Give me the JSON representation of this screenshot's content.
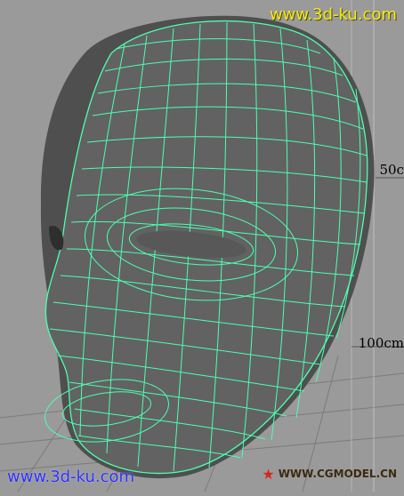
{
  "watermarks": {
    "top": "www.3d-ku.com",
    "bottom": "www.3d-ku.com",
    "corner": "WWW.CGMODEL.CN"
  },
  "ruler": {
    "label_50": "50c",
    "label_100": "100cm"
  },
  "colors": {
    "background": "#9a9a9a",
    "mesh_fill": "#5f5f5f",
    "wireframe": "#4dffb0",
    "watermark_top": "#f4e81a",
    "watermark_bottom": "#2a2cff"
  }
}
